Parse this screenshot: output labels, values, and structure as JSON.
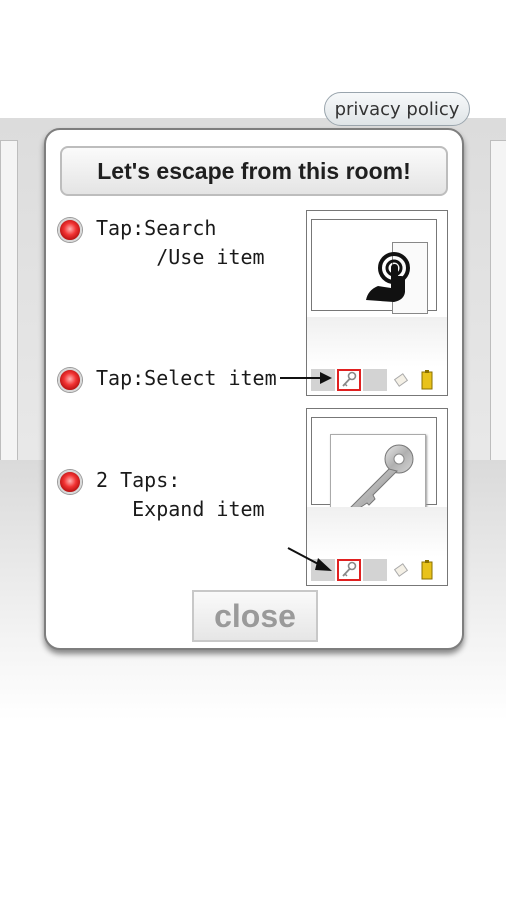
{
  "header": {
    "privacy_label": "privacy policy"
  },
  "dialog": {
    "title": "Let's escape from this room!",
    "instructions": [
      {
        "text": "Tap:Search\n     /Use item"
      },
      {
        "text": "Tap:Select item"
      },
      {
        "text": "2 Taps:\n   Expand item"
      }
    ],
    "close_label": "close"
  },
  "icons": {
    "bullet": "red-dot-icon",
    "tap": "tap-hand-icon",
    "key": "key-icon",
    "arrow": "arrow-right-icon"
  },
  "colors": {
    "bullet": "#f23333",
    "selected_slot": "#e02020",
    "item_yellow": "#e8c21a"
  }
}
